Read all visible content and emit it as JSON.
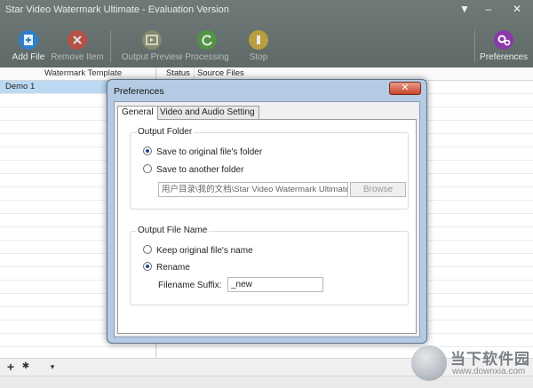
{
  "app": {
    "title": "Star Video Watermark Ultimate - Evaluation Version",
    "window_controls": {
      "menu": "▼",
      "minimize": "–",
      "close": "✕"
    }
  },
  "toolbar": {
    "add_file": "Add File",
    "remove_item": "Remove Item",
    "output_preview": "Output Preview",
    "processing": "Processing",
    "stop": "Stop",
    "preferences": "Preferences"
  },
  "left_panel": {
    "header": "Watermark Template",
    "items": [
      "Demo 1"
    ]
  },
  "right_panel": {
    "columns": [
      "Status",
      "Source Files"
    ]
  },
  "bottom_bar": {
    "add": "+",
    "settings": "✱",
    "dropdown": "▾"
  },
  "dialog": {
    "title": "Preferences",
    "close": "✕",
    "tabs": [
      "General",
      "Video and Audio Setting"
    ],
    "output_folder": {
      "title": "Output Folder",
      "option_original": "Save to original file's folder",
      "option_another": "Save to another folder",
      "path": "用户目录\\我的文档\\Star Video Watermark Ultimate",
      "browse": "Browse"
    },
    "output_file_name": {
      "title": "Output File Name",
      "option_keep": "Keep original file's name",
      "option_rename": "Rename",
      "suffix_label": "Filename Suffix:",
      "suffix_value": "_new"
    }
  },
  "watermark": {
    "text": "当下软件园",
    "url": "www.downxia.com"
  },
  "colors": {
    "toolbar_bg": "#65706e",
    "add_file_icon": "#2f7fd0",
    "remove_icon": "#c94a3c",
    "processing_icon": "#4e9a3c",
    "stop_icon": "#c8a636",
    "preferences_icon": "#8a3aa8",
    "selection": "#bcd9f3"
  }
}
